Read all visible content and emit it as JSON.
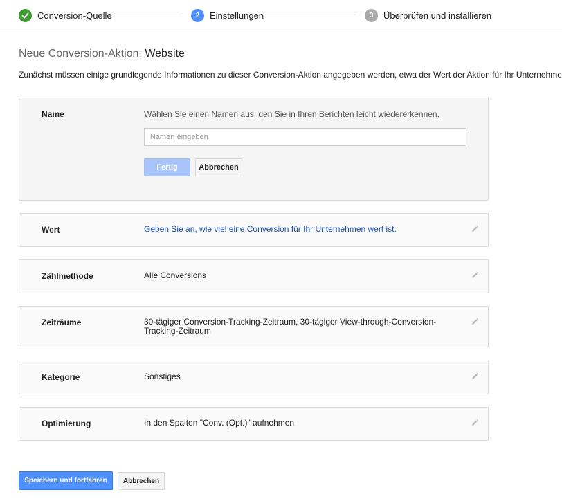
{
  "stepper": {
    "steps": [
      {
        "number": "",
        "label": "Conversion-Quelle",
        "state": "done",
        "icon": "check-icon"
      },
      {
        "number": "2",
        "label": "Einstellungen",
        "state": "active"
      },
      {
        "number": "3",
        "label": "Überprüfen und installieren",
        "state": "pending"
      }
    ]
  },
  "header": {
    "title_prefix": "Neue Conversion-Aktion:",
    "title_type": "Website",
    "description": "Zunächst müssen einige grundlegende Informationen zu dieser Conversion-Aktion angegeben werden, etwa der Wert der Aktion für Ihr Unternehmen."
  },
  "name_section": {
    "label": "Name",
    "hint": "Wählen Sie einen Namen aus, den Sie in Ihren Berichten leicht wiedererkennen.",
    "input_value": "",
    "input_placeholder": "Namen eingeben",
    "done_label": "Fertig",
    "cancel_label": "Abbrechen"
  },
  "settings": [
    {
      "label": "Wert",
      "value": "Geben Sie an, wie viel eine Conversion für Ihr Unternehmen wert ist."
    },
    {
      "label": "Zählmethode",
      "value": "Alle Conversions"
    },
    {
      "label": "Zeiträume",
      "value": "30-tägiger Conversion-Tracking-Zeitraum, 30-tägiger View-through-Conversion-Tracking-Zeitraum"
    },
    {
      "label": "Kategorie",
      "value": "Sonstiges"
    },
    {
      "label": "Optimierung",
      "value": "In den Spalten \"Conv. (Opt.)\" aufnehmen"
    }
  ],
  "footer": {
    "save_label": "Speichern und fortfahren",
    "cancel_label": "Abbrechen"
  },
  "colors": {
    "accent": "#4d90fe",
    "success": "#3c9a2e",
    "link": "#1a4fbf"
  }
}
